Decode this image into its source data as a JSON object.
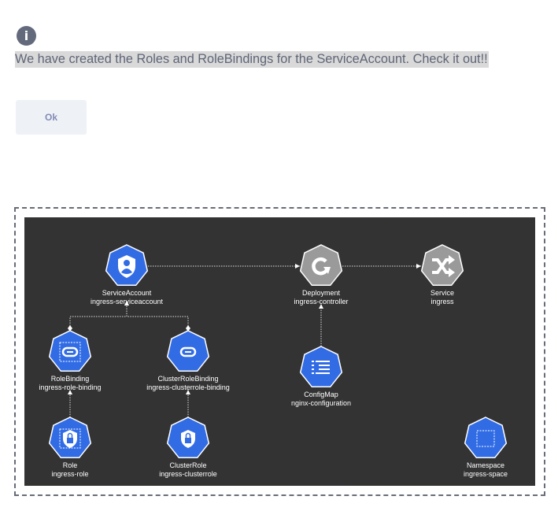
{
  "dialog": {
    "icon": "info-icon",
    "message": "We have created the Roles and RoleBindings for the ServiceAccount. Check it out!!",
    "ok_label": "Ok"
  },
  "diagram": {
    "background": "#333333",
    "colors": {
      "blue": "#326ce5",
      "gray": "#9a9a9a"
    },
    "nodes": [
      {
        "id": "sa",
        "kind": "ServiceAccount",
        "name": "ingress-serviceaccount",
        "icon": "user-shield-icon",
        "color": "blue"
      },
      {
        "id": "deploy",
        "kind": "Deployment",
        "name": "ingress-controller",
        "icon": "refresh-icon",
        "color": "gray"
      },
      {
        "id": "svc",
        "kind": "Service",
        "name": "ingress",
        "icon": "shuffle-icon",
        "color": "gray"
      },
      {
        "id": "rb",
        "kind": "RoleBinding",
        "name": "ingress-role-binding",
        "icon": "link-icon",
        "color": "blue",
        "dashed_box": true
      },
      {
        "id": "crb",
        "kind": "ClusterRoleBinding",
        "name": "ingress-clusterrole-binding",
        "icon": "link-icon",
        "color": "blue"
      },
      {
        "id": "cm",
        "kind": "ConfigMap",
        "name": "nginx-configuration",
        "icon": "list-icon",
        "color": "blue"
      },
      {
        "id": "role",
        "kind": "Role",
        "name": "ingress-role",
        "icon": "lock-shield-icon",
        "color": "blue",
        "dashed_box": true
      },
      {
        "id": "cr",
        "kind": "ClusterRole",
        "name": "ingress-clusterrole",
        "icon": "lock-shield-icon",
        "color": "blue"
      },
      {
        "id": "ns",
        "kind": "Namespace",
        "name": "ingress-space",
        "icon": "dashed-square-icon",
        "color": "blue"
      }
    ],
    "edges": [
      {
        "from": "sa",
        "to": "deploy"
      },
      {
        "from": "deploy",
        "to": "svc"
      },
      {
        "from": "cm",
        "to": "deploy"
      },
      {
        "from": "rb",
        "to": "sa"
      },
      {
        "from": "crb",
        "to": "sa"
      },
      {
        "from": "role",
        "to": "rb"
      },
      {
        "from": "cr",
        "to": "crb"
      }
    ]
  }
}
